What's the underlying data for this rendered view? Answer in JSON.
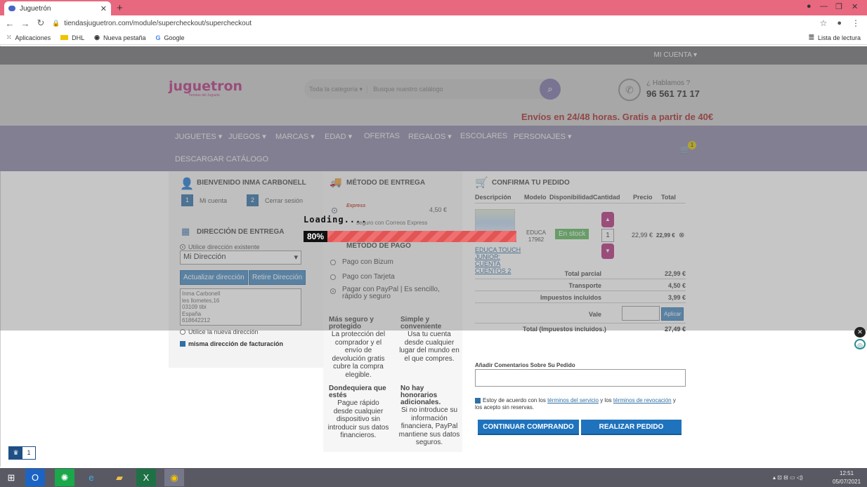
{
  "browser": {
    "tab_title": "Juguetrón",
    "tab_close": "✕",
    "new_tab": "+",
    "url": "tiendasjuguetron.com/module/supercheckout/supercheckout",
    "back": "←",
    "forward": "→",
    "reload": "↻",
    "bookmarks": [
      "Aplicaciones",
      "DHL",
      "Nueva pestaña",
      "Google"
    ],
    "reading_list": "Lista de lectura"
  },
  "top": {
    "my_account": "MI CUENTA ▾"
  },
  "header": {
    "logo": "juguetron",
    "logo_sub": "Tiendas del Juguete",
    "search_category": "Toda la categoría ▾",
    "search_placeholder": "Busque nuestro catálogo",
    "help_label": "¿ Hablamos ?",
    "phone": "96 561 71 17",
    "shipping_banner": "Envíos en 24/48 horas. Gratis a partir de 40€"
  },
  "nav": {
    "items": [
      "JUGUETES ▾",
      "JUEGOS ▾",
      "MARCAS ▾",
      "EDAD ▾",
      "OFERTAS",
      "REGALOS ▾",
      "ESCOLARES",
      "PERSONAJES ▾"
    ],
    "catalog": "DESCARGAR CATÁLOGO",
    "cart_count": "1"
  },
  "col1": {
    "welcome": "BIENVENIDO INMA CARBONELL",
    "step1_num": "1",
    "step1_label": "Mi cuenta",
    "step2_num": "2",
    "step2_label": "Cerrar sesión",
    "delivery_title": "DIRECCIÓN DE ENTREGA",
    "use_existing": "Utilice dirección existente",
    "selected_address": "Mi Dirección",
    "update_btn": "Actualizar dirección",
    "remove_btn": "Retire Dirección",
    "address_lines": [
      "Inma Carbonell",
      "les llometes,16",
      "03109 tibi",
      "España",
      "618642212"
    ],
    "use_new": "Utilice la nueva dirección",
    "same_billing": "misma dirección de facturación"
  },
  "col2": {
    "shipping_title": "MÉTODO DE ENTREGA",
    "carrier_logo": "Express",
    "carrier_price": "4,50 €",
    "carrier_desc": "seguro con Correos Express",
    "payment_title": "MÉTODO DE PAGO",
    "pay_options": [
      "Pago con Bizum",
      "Pago con Tarjeta",
      "Pagar con PayPal | Es sencillo, rápido y seguro"
    ],
    "benefits": [
      {
        "title": "Más seguro y protegido",
        "text": "La protección del comprador y el envío de devolución gratis cubre la compra elegible."
      },
      {
        "title": "Simple y conveniente",
        "text": "Usa tu cuenta desde cualquier lugar del mundo en el que compres."
      },
      {
        "title": "Dondequiera que estés",
        "text": "Pague rápido desde cualquier dispositivo sin introducir sus datos financieros."
      },
      {
        "title": "No hay honorarios adicionales.",
        "text": "Si no introduce su información financiera, PayPal mantiene sus datos seguros."
      }
    ]
  },
  "col3": {
    "title": "CONFIRMA TU PEDIDO",
    "headers": [
      "Descripción",
      "Modelo",
      "Disponibilidad",
      "Cantidad",
      "Precio",
      "Total"
    ],
    "product": {
      "name": "EDUCA TOUCH JUNIOR: CUENTA CUENTOS 2",
      "model": "EDUCA 17962",
      "stock": "En stock",
      "qty": "1",
      "price": "22,99 €",
      "total": "22,99 €"
    },
    "summary": [
      {
        "label": "Total parcial",
        "value": "22,99 €"
      },
      {
        "label": "Transporte",
        "value": "4,50 €"
      },
      {
        "label": "Impuestos incluidos",
        "value": "3,99 €"
      }
    ],
    "voucher_label": "Vale",
    "apply_btn": "Aplicar",
    "grand_label": "Total (Impuestos incluidos.)",
    "grand_value": "27,49 €",
    "comments_label": "Añadir Comentarios Sobre Su Pedido",
    "terms_pre": "Estoy de acuerdo con los ",
    "terms_link1": "términos del servicio",
    "terms_mid": " y los ",
    "terms_link2": "términos de revocación",
    "terms_post": " y los acepto sin reservas.",
    "continue_btn": "CONTINUAR COMPRANDO",
    "order_btn": "REALIZAR PEDIDO"
  },
  "loader": {
    "text": "Loading....",
    "percent": "80%",
    "progress": 0.8
  },
  "widget": {
    "count": "1"
  },
  "taskbar": {
    "time": "12:51",
    "date": "05/07/2021"
  },
  "colors": {
    "accent": "#4488c2",
    "brand": "#b4307e",
    "nav": "#8a85a5",
    "progress": "#e35454"
  }
}
